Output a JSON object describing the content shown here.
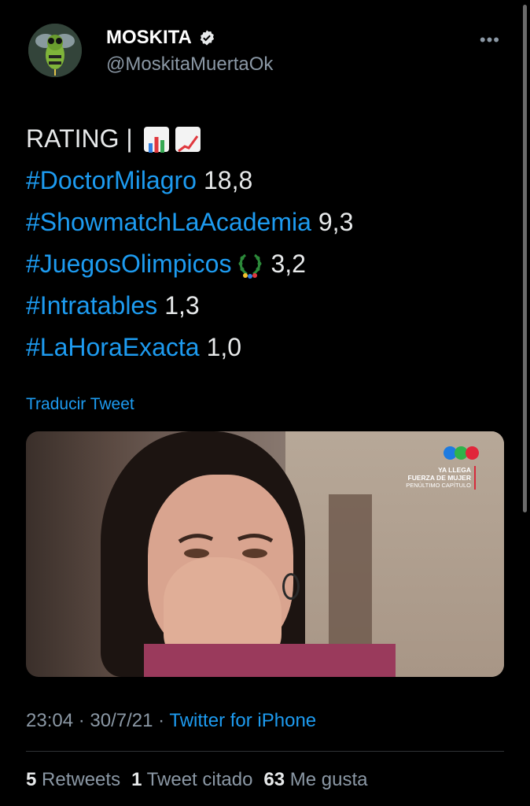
{
  "user": {
    "display_name": "MOSKITA",
    "handle": "@MoskitaMuertaOk",
    "avatar_icon": "mosquito-avatar-icon",
    "verified_icon": "verified-badge-icon"
  },
  "more_icon": "more-options-icon",
  "tweet": {
    "heading": "RATING |",
    "heading_emojis": [
      "bar-chart-emoji",
      "chart-increasing-emoji"
    ],
    "lines": [
      {
        "tag": "#DoctorMilagro",
        "value": "18,8"
      },
      {
        "tag": "#ShowmatchLaAcademia",
        "value": "9,3"
      },
      {
        "tag": "#JuegosOlimpicos",
        "value": "3,2"
      },
      {
        "tag": "#Intratables",
        "value": "1,3"
      },
      {
        "tag": "#LaHoraExacta",
        "value": "1,0"
      }
    ],
    "laurel_emoji": "olympic-laurel-emoji"
  },
  "translate_label": "Traducir Tweet",
  "media": {
    "promo_line1": "YA LLEGA",
    "promo_line2": "FUERZA DE MUJER",
    "promo_line3": "PENÚLTIMO CAPÍTULO",
    "logo_colors": [
      "#1e7be0",
      "#2fb34a",
      "#e1263a"
    ]
  },
  "meta": {
    "time": "23:04",
    "date": "30/7/21",
    "source": "Twitter for iPhone"
  },
  "stats": {
    "retweets_count": "5",
    "retweets_label": "Retweets",
    "quotes_count": "1",
    "quotes_label": "Tweet citado",
    "likes_count": "63",
    "likes_label": "Me gusta"
  },
  "colors": {
    "accent": "#1d9bf0",
    "background": "#000000",
    "secondary_text": "#8b98a5"
  }
}
